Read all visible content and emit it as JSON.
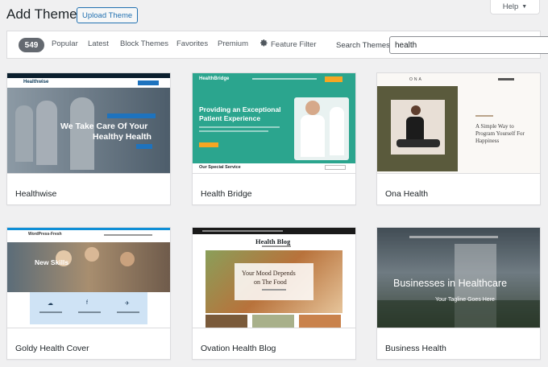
{
  "header": {
    "title": "Add Themes",
    "upload_label": "Upload Theme",
    "help_label": "Help"
  },
  "filters": {
    "count": "549",
    "tabs": [
      "Popular",
      "Latest",
      "Block Themes",
      "Favorites",
      "Premium"
    ],
    "feature_filter": "Feature Filter",
    "search_label": "Search Themes",
    "search_value": "health"
  },
  "themes": [
    {
      "name": "Healthwise",
      "preview": {
        "logo": "Healthwise",
        "headline_1": "We Take Care Of Your",
        "headline_2": "Healthy Health"
      }
    },
    {
      "name": "Health Bridge",
      "preview": {
        "logo": "HealthBridge",
        "headline_1": "Providing an Exceptional",
        "headline_2": "Patient Experience",
        "section": "Our Special Service"
      }
    },
    {
      "name": "Ona Health",
      "preview": {
        "logo": "ONA",
        "tagline_1": "A Simple Way to",
        "tagline_2": "Program Yourself For",
        "tagline_3": "Happiness"
      }
    },
    {
      "name": "Goldy Health Cover",
      "preview": {
        "logo": "WordPress-Fresh",
        "headline": "New Skills"
      }
    },
    {
      "name": "Ovation Health Blog",
      "preview": {
        "logo": "Health Blog",
        "headline_1": "Your Mood Depends",
        "headline_2": "on The Food"
      }
    },
    {
      "name": "Business Health",
      "preview": {
        "headline": "Businesses in Healthcare",
        "subline": "Your Tagline Goes Here"
      }
    }
  ],
  "colors": {
    "accent": "#2271b1",
    "badge": "#646970",
    "healthbridge_green": "#2ba58e",
    "ona_olive": "#5a5a3c"
  }
}
